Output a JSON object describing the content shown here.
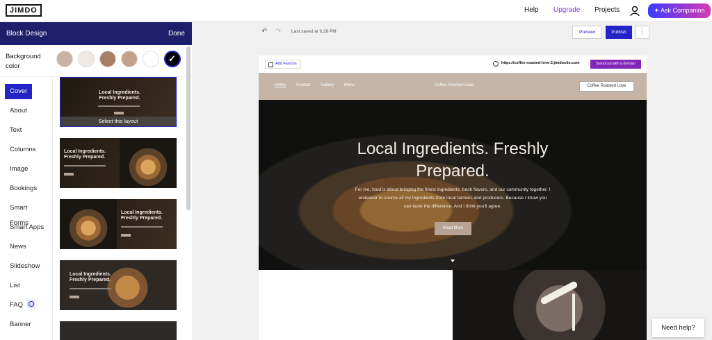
{
  "topbar": {
    "logo": "JIMDO",
    "help": "Help",
    "upgrade": "Upgrade",
    "projects": "Projects",
    "ask_companion": "Ask Companion",
    "accent_color": "#2323c8"
  },
  "left_panel": {
    "title": "Block Design",
    "done": "Done",
    "background_color_label": "Background color",
    "swatches": [
      {
        "color": "#c8b3a2",
        "selected": false
      },
      {
        "color": "#efeae6",
        "selected": false
      },
      {
        "color": "#a77e61",
        "selected": false
      },
      {
        "color": "#c4a18a",
        "selected": false
      },
      {
        "color": "#ffffff",
        "selected": false
      },
      {
        "color": "#000000",
        "selected": true
      }
    ],
    "categories": [
      "Cover",
      "About",
      "Text",
      "Columns",
      "Image",
      "Bookings",
      "Smart Forms",
      "Smart Apps",
      "News",
      "Slideshow",
      "List",
      "FAQ",
      "Banner"
    ],
    "active_category": "Cover",
    "layouts": [
      {
        "title": "Local Ingredients. Freshly Prepared.",
        "action": "Select this layout",
        "selected": true
      },
      {
        "title": "Local Ingredients. Freshly Prepared."
      },
      {
        "title": "Local Ingredients. Freshly Prepared."
      },
      {
        "title": "Local Ingredients. Freshly Prepared."
      }
    ]
  },
  "editor": {
    "undo_icon": "undo-icon",
    "redo_icon": "redo-icon",
    "last_saved": "Last saved at 6:28 PM",
    "preview": "Preview",
    "publish": "Publish",
    "more": "⋮"
  },
  "site": {
    "add_favicon": "Add Favicon",
    "domain": "https://coffee-roasted-love-2.jimdosite.com",
    "domain_cta": "Stand out with a domain",
    "nav": [
      "Home",
      "Contact",
      "Gallery",
      "Menu"
    ],
    "site_name": "Coffee Roasted Love",
    "nav_cta": "Coffee Roasted Love",
    "hero": {
      "title": "Local Ingredients. Freshly Prepared.",
      "text": "For me, food is about bringing the finest ingredients, fresh flavors, and our community together. I endeavor to source all my ingredients from local farmers and producers. Because I know you can taste the difference. And I think you'll agree.",
      "button": "Read More"
    }
  },
  "help": {
    "label": "Need help?"
  }
}
